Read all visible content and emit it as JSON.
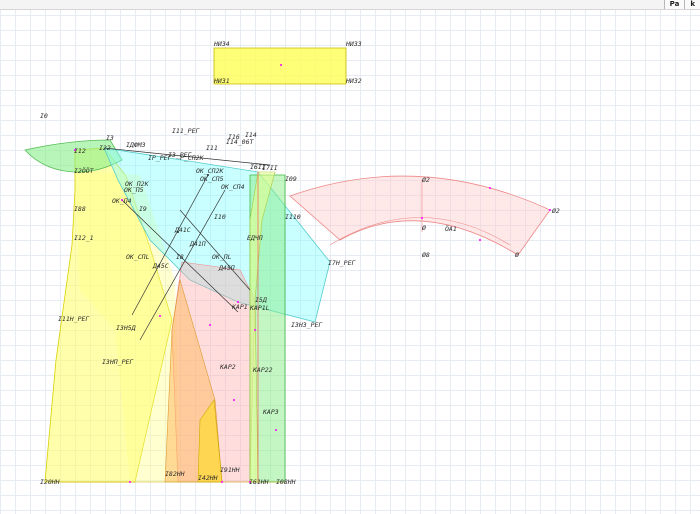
{
  "toolbar": {
    "buttons": [
      {
        "label": "Pa",
        "icon": "pattern-mode-icon"
      },
      {
        "label": "k",
        "icon": "knit-mode-icon"
      }
    ]
  },
  "colors": {
    "grid": "#e6ecf2",
    "yellow_piece": "#ffff55",
    "green_piece": "#88ee88",
    "cyan_piece": "#88ffff",
    "red_piece": "#ffaaaa",
    "orange_piece": "#ffbb66",
    "construction_line": "#333333",
    "point_marker": "#ff00ff"
  },
  "pieces": [
    {
      "name": "rect-piece",
      "points": [
        "НИЗ4",
        "НИЗ3",
        "НИЗ1",
        "НИЗ2"
      ]
    },
    {
      "name": "front-piece",
      "points": [
        "I12",
        "I88",
        "I12_1",
        "I11Н_РЕГ",
        "I20НН"
      ]
    },
    {
      "name": "sleeve-piece",
      "points": [
        "I7Н_РЕГ",
        "I3Н3_РЕГ",
        "ДК_П4",
        "ДК_П5"
      ]
    },
    {
      "name": "arc-piece",
      "points": [
        "Ø2",
        "Ø2",
        "ÖА1",
        "Ø8"
      ]
    }
  ],
  "labels": {
    "niz4": "НИЗ4",
    "niz3": "НИЗ3",
    "niz1": "НИЗ1",
    "niz2": "НИЗ2",
    "i0": "I0",
    "i3": "I3",
    "i12": "I12",
    "i22": "I22",
    "i7uat": "I2ÖÖT",
    "i88": "I88",
    "i12_1": "I12_1",
    "i11n": "I11Н_РЕГ",
    "i3np": "I3НП_РЕГ",
    "i20nn": "I20НН",
    "i82nn": "I82НН",
    "i42nn": "I42НН",
    "i91nn": "I91НН",
    "i61nn": "I61НН",
    "i08nn": "I08НН",
    "i11_reg": "I11_РЕГ",
    "ip_reg": "IР_РЕГ",
    "i3_reg": "I3_РЕГ",
    "p_cp2k": "Р_СП2К",
    "idfm3": "IДФМ3",
    "i11": "I11",
    "i16": "I16",
    "i14": "I14",
    "i14_06t": "I14_06Т",
    "i6ii": "I6II",
    "i7ii": "I7II",
    "i09": "I09",
    "ok_cp2k": "ОК_СП2К",
    "ok_cp5": "ОК_СП5",
    "ok_n2k": "ОК_П2К",
    "ok_n5": "ОК_П5",
    "ok_n4": "ОК_П4",
    "ok_cp4": "ОК_СП4",
    "i9": "I9",
    "i10": "I10",
    "i110": "I110",
    "a41c": "Д41С",
    "a41n": "Д41П",
    "ok_cnl": "ОК_СПL",
    "ok_nl": "ОК_ПL",
    "i8": "I8",
    "a45c": "Д45С",
    "a45n": "Д45П",
    "ea4n": "ЕДЧП",
    "i54": "I5Д",
    "kap1": "КАР1",
    "kap1l": "КАР1L",
    "i3n5a": "I3Н5Д",
    "i3h3": "I3Н3_РЕГ",
    "kap2": "КАР2",
    "kap22": "КАР22",
    "kap3": "КАР3",
    "i7h": "I7Н_РЕГ",
    "arc_o2_top": "Ø2",
    "arc_o2_right": "Ø2",
    "arc_o": "Ø",
    "arc_oa1": "ÖА1",
    "arc_o8": "Ø8",
    "arc_zero": "Ø"
  }
}
